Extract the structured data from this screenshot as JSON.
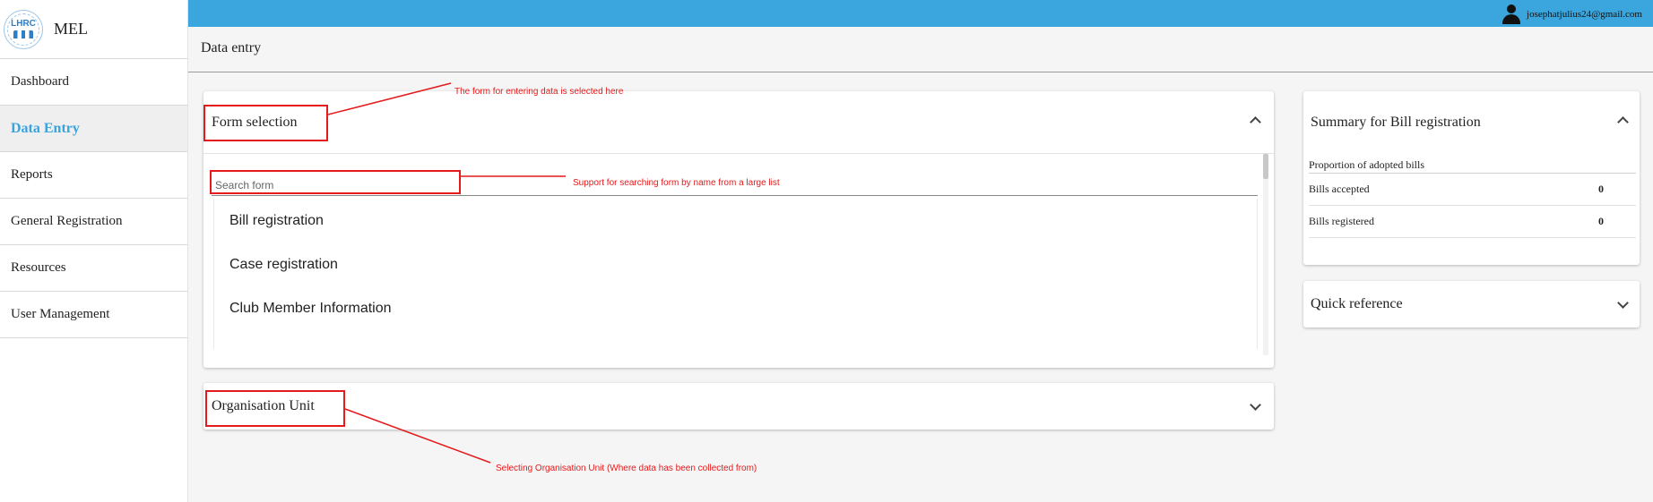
{
  "brand": {
    "logo_text": "LHRC",
    "name": "MEL"
  },
  "sidebar": {
    "items": [
      {
        "label": "Dashboard",
        "active": false
      },
      {
        "label": "Data Entry",
        "active": true
      },
      {
        "label": "Reports",
        "active": false
      },
      {
        "label": "General Registration",
        "active": false
      },
      {
        "label": "Resources",
        "active": false
      },
      {
        "label": "User Management",
        "active": false
      }
    ]
  },
  "topbar": {
    "user_email": "josephatjulius24@gmail.com",
    "icon": "user-icon"
  },
  "page": {
    "title": "Data entry"
  },
  "form_selection": {
    "title": "Form selection",
    "search_placeholder": "Search form",
    "forms": [
      "Bill registration",
      "Case registration",
      "Club Member Information"
    ],
    "expanded": true
  },
  "org_unit": {
    "title": "Organisation Unit",
    "expanded": false
  },
  "summary": {
    "title": "Summary for Bill registration",
    "section_label": "Proportion of adopted bills",
    "rows": [
      {
        "label": "Bills accepted",
        "value": "0"
      },
      {
        "label": "Bills registered",
        "value": "0"
      }
    ],
    "expanded": true
  },
  "quick_reference": {
    "title": "Quick reference",
    "expanded": false
  },
  "annotations": {
    "form_selection": "The form for entering data is selected here",
    "search": "Support for searching form by name from a large list",
    "org_unit": "Selecting Organisation Unit (Where data has been collected from)"
  },
  "colors": {
    "topbar": "#3ba6dd",
    "active_nav": "#3aa3dc",
    "annotation": "#e41a1c"
  }
}
